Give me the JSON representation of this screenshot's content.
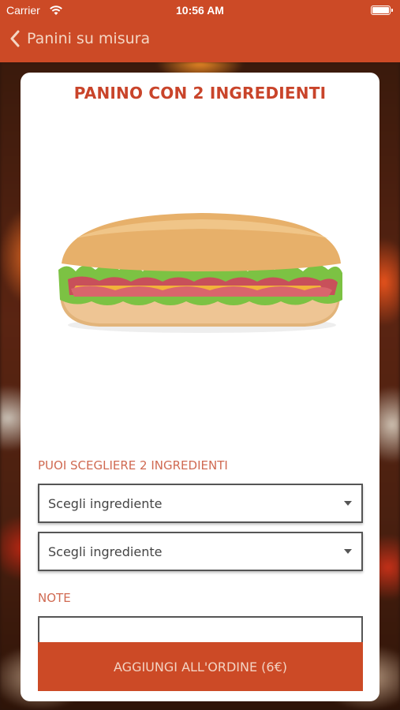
{
  "status_bar": {
    "carrier": "Carrier",
    "time": "10:56 AM"
  },
  "nav": {
    "back_label": "Panini su misura"
  },
  "product": {
    "title": "PANINO CON 2 INGREDIENTI",
    "image_icon": "sandwich-image"
  },
  "form": {
    "choose_label": "PUOI SCEGLIERE 2 INGREDIENTI",
    "selects": [
      {
        "value": "Scegli ingrediente"
      },
      {
        "value": "Scegli ingrediente"
      }
    ],
    "note_label": "NOTE",
    "note_value": ""
  },
  "actions": {
    "add_label": "AGGIUNGI ALL'ORDINE (6€)"
  },
  "colors": {
    "accent": "#cc4a26",
    "label": "#d06a52",
    "title": "#c9442a"
  }
}
